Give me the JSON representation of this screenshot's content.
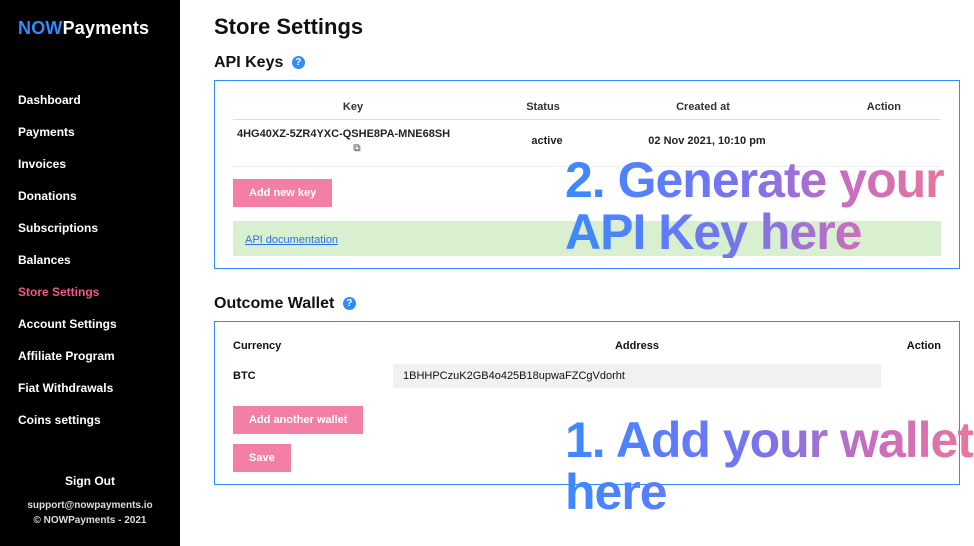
{
  "logo": {
    "part1": "NOW",
    "part2": "Payments"
  },
  "nav": {
    "items": [
      {
        "label": "Dashboard",
        "active": false
      },
      {
        "label": "Payments",
        "active": false
      },
      {
        "label": "Invoices",
        "active": false
      },
      {
        "label": "Donations",
        "active": false
      },
      {
        "label": "Subscriptions",
        "active": false
      },
      {
        "label": "Balances",
        "active": false
      },
      {
        "label": "Store Settings",
        "active": true
      },
      {
        "label": "Account Settings",
        "active": false
      },
      {
        "label": "Affiliate Program",
        "active": false
      },
      {
        "label": "Fiat Withdrawals",
        "active": false
      },
      {
        "label": "Coins settings",
        "active": false
      }
    ],
    "sign_out": "Sign Out",
    "support_email": "support@nowpayments.io",
    "copyright": "© NOWPayments - 2021"
  },
  "page": {
    "title": "Store Settings"
  },
  "api_keys": {
    "section_title": "API Keys",
    "columns": {
      "key": "Key",
      "status": "Status",
      "created": "Created at",
      "action": "Action"
    },
    "rows": [
      {
        "key": "4HG40XZ-5ZR4YXC-QSHE8PA-MNE68SH",
        "status": "active",
        "created": "02 Nov 2021, 10:10 pm"
      }
    ],
    "add_btn": "Add new key",
    "doc_link": "API documentation"
  },
  "wallet": {
    "section_title": "Outcome Wallet",
    "columns": {
      "currency": "Currency",
      "address": "Address",
      "action": "Action"
    },
    "rows": [
      {
        "currency": "BTC",
        "address": "1BHHPCzuK2GB4o425B18upwaFZCgVdorht"
      }
    ],
    "add_btn": "Add another wallet",
    "save_btn": "Save"
  },
  "overlays": {
    "line1": "2. Generate your\nAPI Key here",
    "line2": "1. Add your wallet\nhere"
  }
}
